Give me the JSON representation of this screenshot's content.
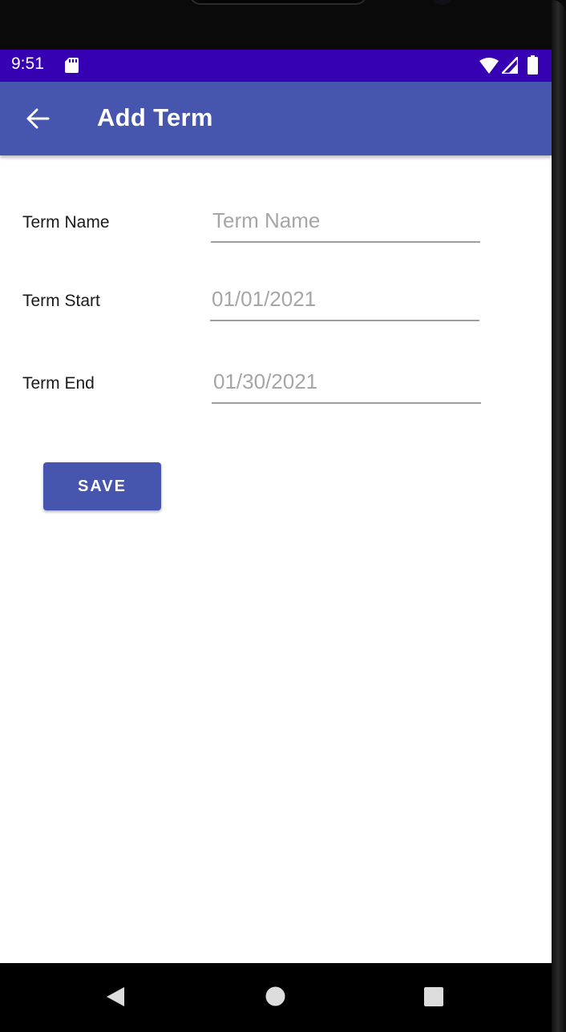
{
  "status_bar": {
    "time": "9:51",
    "icons": [
      "sd-card-icon",
      "wifi-icon",
      "signal-icon",
      "battery-icon"
    ],
    "background": "#3700b3"
  },
  "app_bar": {
    "title": "Add Term",
    "back_icon": "arrow-back-icon",
    "background": "#4655ad"
  },
  "form": {
    "term_name": {
      "label": "Term Name",
      "value": "",
      "placeholder": "Term Name"
    },
    "term_start": {
      "label": "Term Start",
      "value": "",
      "placeholder": "01/01/2021"
    },
    "term_end": {
      "label": "Term End",
      "value": "",
      "placeholder": "01/30/2021"
    },
    "save_label": "SAVE"
  },
  "nav_bar": {
    "icons": [
      "nav-back-icon",
      "nav-home-icon",
      "nav-recents-icon"
    ]
  },
  "colors": {
    "accent": "#4655ad",
    "status_bar": "#3700b3",
    "hint_text": "#9e9e9e"
  }
}
